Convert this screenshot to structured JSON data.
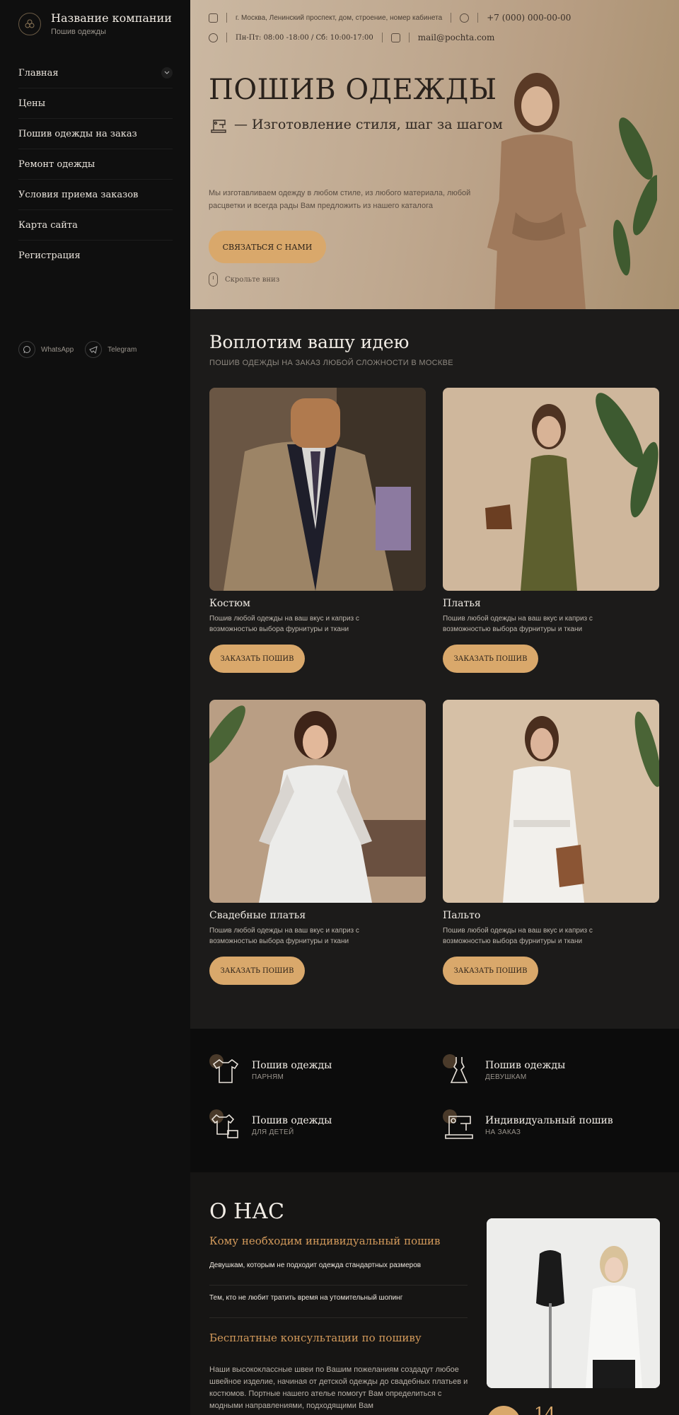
{
  "brand": {
    "name": "Название компании",
    "subtitle": "Пошив одежды"
  },
  "nav": {
    "items": [
      {
        "label": "Главная",
        "has_submenu": true
      },
      {
        "label": "Цены"
      },
      {
        "label": "Пошив одежды на заказ"
      },
      {
        "label": "Ремонт одежды"
      },
      {
        "label": "Условия приема заказов"
      },
      {
        "label": "Карта сайта"
      },
      {
        "label": "Регистрация"
      }
    ]
  },
  "socials": [
    {
      "label": "WhatsApp",
      "icon": "whatsapp-icon"
    },
    {
      "label": "Telegram",
      "icon": "telegram-icon"
    }
  ],
  "contacts": {
    "address": "г. Москва, Ленинский проспект, дом, строение, номер кабинета",
    "phone": "+7 (000) 000-00-00",
    "hours": "Пн-Пт: 08:00 -18:00 / Сб: 10:00-17:00",
    "email": "mail@pochta.com"
  },
  "hero": {
    "title": "ПОШИВ ОДЕЖДЫ",
    "subtitle": "—  Изготовление стиля, шаг за шагом",
    "description": "Мы изготавливаем одежду в любом стиле, из любого материала, любой расцветки и всегда рады Вам предложить из нашего каталога",
    "button": "СВЯЗАТЬСЯ С НАМИ",
    "scroll": "Скрольте вниз"
  },
  "ideas": {
    "title": "Воплотим вашу идею",
    "subtitle": "ПОШИВ ОДЕЖДЫ НА ЗАКАЗ ЛЮБОЙ СЛОЖНОСТИ В МОСКВЕ",
    "cards": [
      {
        "title": "Костюм",
        "desc": "Пошив любой одежды на ваш вкус и каприз с возможностью выбора фурнитуры и ткани",
        "button": "ЗАКАЗАТЬ ПОШИВ"
      },
      {
        "title": "Платья",
        "desc": "Пошив любой одежды на ваш вкус и каприз с возможностью выбора фурнитуры и ткани",
        "button": "ЗАКАЗАТЬ ПОШИВ"
      },
      {
        "title": "Свадебные платья",
        "desc": "Пошив любой одежды на ваш вкус и каприз с возможностью выбора фурнитуры и ткани",
        "button": "ЗАКАЗАТЬ ПОШИВ"
      },
      {
        "title": "Пальто",
        "desc": "Пошив любой одежды на ваш вкус и каприз с возможностью выбора фурнитуры и ткани",
        "button": "ЗАКАЗАТЬ ПОШИВ"
      }
    ]
  },
  "services": [
    {
      "title": "Пошив одежды",
      "sub": "ПАРНЯМ",
      "icon": "shirt-icon"
    },
    {
      "title": "Пошив одежды",
      "sub": "ДЕВУШКАМ",
      "icon": "dress-icon"
    },
    {
      "title": "Пошив одежды",
      "sub": "ДЛЯ ДЕТЕЙ",
      "icon": "kids-clothes-icon"
    },
    {
      "title": "Индивидуальный пошив",
      "sub": "НА ЗАКАЗ",
      "icon": "sewing-machine-icon"
    }
  ],
  "about": {
    "title": "О НАС",
    "heading1": "Кому необходим индивидуальный пошив",
    "items": [
      "Девушкам, которым не подходит одежда стандартных размеров",
      "Тем, кто не любит тратить время на утомительный шопинг"
    ],
    "heading2": "Бесплатные консультации по пошиву",
    "text": "Наши высококлассные швеи по Вашим пожеланиям создадут любое швейное изделие, начиная от детской одежды до свадебных платьев и костюмов. Портные нашего ателье помогут Вам определиться с модными направлениями, подходящими Вам",
    "badge_number": "14"
  },
  "colors": {
    "accent": "#d9a86b",
    "sidebar": "#0f0f0f",
    "section": "#1c1b1a"
  }
}
